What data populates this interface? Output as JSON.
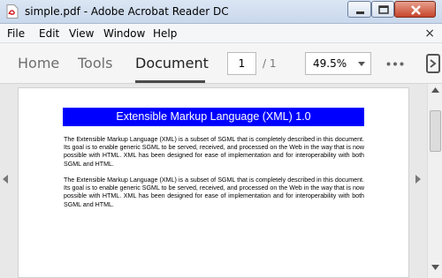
{
  "window": {
    "title": "simple.pdf - Adobe Acrobat Reader DC",
    "close_glyph": "×"
  },
  "menubar": {
    "items": [
      "File",
      "Edit",
      "View",
      "Window",
      "Help"
    ],
    "close_glyph": "×"
  },
  "toolbar": {
    "tabs": [
      "Home",
      "Tools",
      "Document"
    ],
    "active_tab": "Document",
    "current_page": "1",
    "page_total": "/ 1",
    "zoom": "49.5%"
  },
  "document": {
    "heading": "Extensible Markup Language (XML) 1.0",
    "paragraphs": [
      "The Extensible Markup Language (XML) is a subset of SGML that is completely described in this document. Its goal is to enable generic SGML to be served, received, and processed on the Web in the way that is now possible with HTML. XML has been designed for ease of implementation and for interoperability with both SGML and HTML.",
      "The Extensible Markup Language (XML) is a subset of SGML that is completely described in this document. Its goal is to enable generic SGML to be served, received, and processed on the Web in the way that is now possible with HTML. XML has been designed for ease of implementation and for interoperability with both SGML and HTML."
    ],
    "heading_bg": "#0000ff"
  },
  "icons": {
    "app": "pdf-file-icon",
    "minimize": "minimize-icon",
    "maximize": "maximize-icon",
    "close": "close-icon",
    "zoom_dropdown": "chevron-down-icon",
    "more": "more-options-icon",
    "scroll_up": "scroll-up-arrow-icon",
    "scroll_down": "scroll-down-arrow-icon",
    "prev_page": "left-arrow-icon",
    "next_page": "right-arrow-icon"
  }
}
